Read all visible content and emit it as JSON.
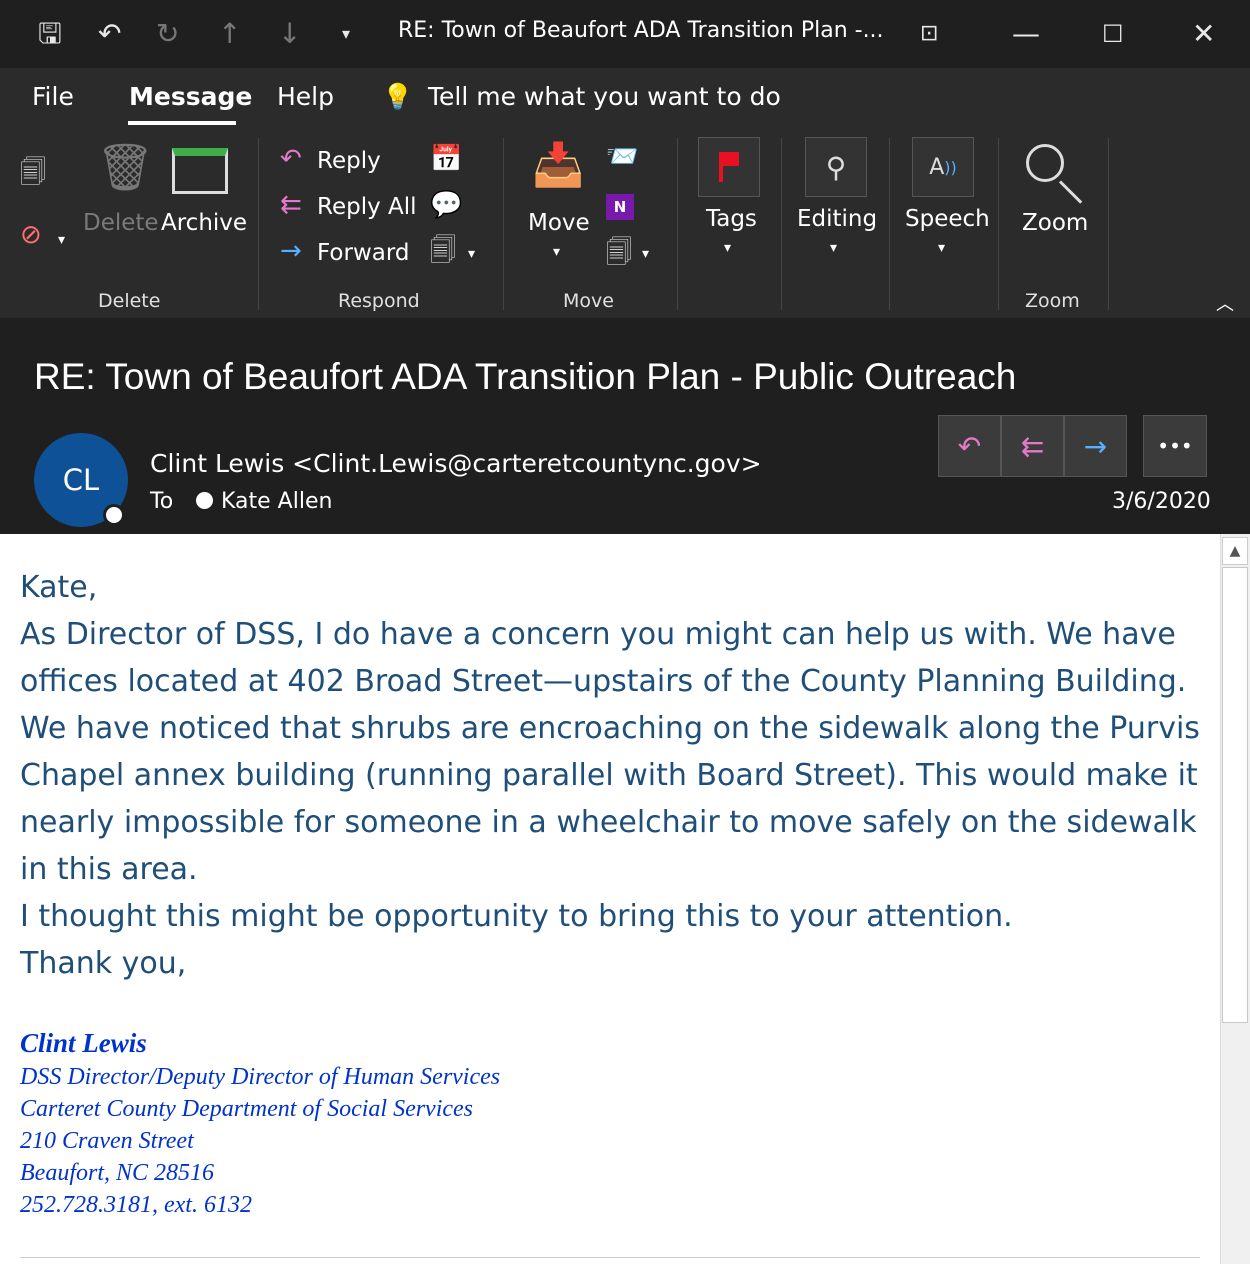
{
  "titlebar": {
    "title": "RE: Town of Beaufort ADA Transition Plan -...",
    "icons": [
      "save-icon",
      "undo-icon",
      "redo-icon",
      "up-arrow-icon",
      "down-arrow-icon",
      "customize-icon",
      "restore-ribbon-icon",
      "minimize-icon",
      "maximize-icon",
      "close-icon"
    ]
  },
  "menu": {
    "file": "File",
    "message": "Message",
    "help": "Help",
    "tellme": "Tell me what you want to do"
  },
  "ribbon": {
    "delete_group": {
      "label": "Delete",
      "delete": "Delete",
      "archive": "Archive"
    },
    "respond_group": {
      "label": "Respond",
      "reply": "Reply",
      "reply_all": "Reply All",
      "forward": "Forward"
    },
    "move_group": {
      "label": "Move",
      "move": "Move"
    },
    "tags": "Tags",
    "editing": "Editing",
    "speech": "Speech",
    "zoom_group": {
      "label": "Zoom",
      "zoom": "Zoom"
    },
    "colors": {
      "flag": "#e81123",
      "onenote": "#7719aa",
      "accent_pink": "#e27ac8",
      "accent_blue": "#58b0ff"
    }
  },
  "message": {
    "subject": "RE: Town of Beaufort ADA Transition Plan - Public Outreach",
    "avatar_initials": "CL",
    "avatar_color": "#0f5196",
    "sender": "Clint Lewis <Clint.Lewis@carteretcountync.gov>",
    "to_label": "To",
    "recipient": "Kate Allen",
    "date": "3/6/2020",
    "more": "•••"
  },
  "body": {
    "lines": [
      "Kate,",
      "As Director of DSS, I do have a concern you might can help us with. We have",
      "offices located at 402 Broad Street—upstairs of the County Planning Building.",
      "We have noticed that shrubs are encroaching on the sidewalk along the Purvis",
      "Chapel annex building (running parallel with Board Street). This would make it",
      "nearly impossible for someone in a wheelchair to move safely on the sidewalk",
      "in this area.",
      "I thought this might be opportunity to bring this to your attention.",
      "Thank you,"
    ],
    "text_color": "#1f4e79"
  },
  "signature": {
    "name": "Clint Lewis",
    "title": "DSS Director/Deputy Director of Human Services",
    "org": "Carteret County Department of Social Services",
    "street": "210 Craven Street",
    "city": "Beaufort, NC 28516",
    "phone": "252.728.3181, ext. 6132",
    "color": "#0033cc"
  }
}
